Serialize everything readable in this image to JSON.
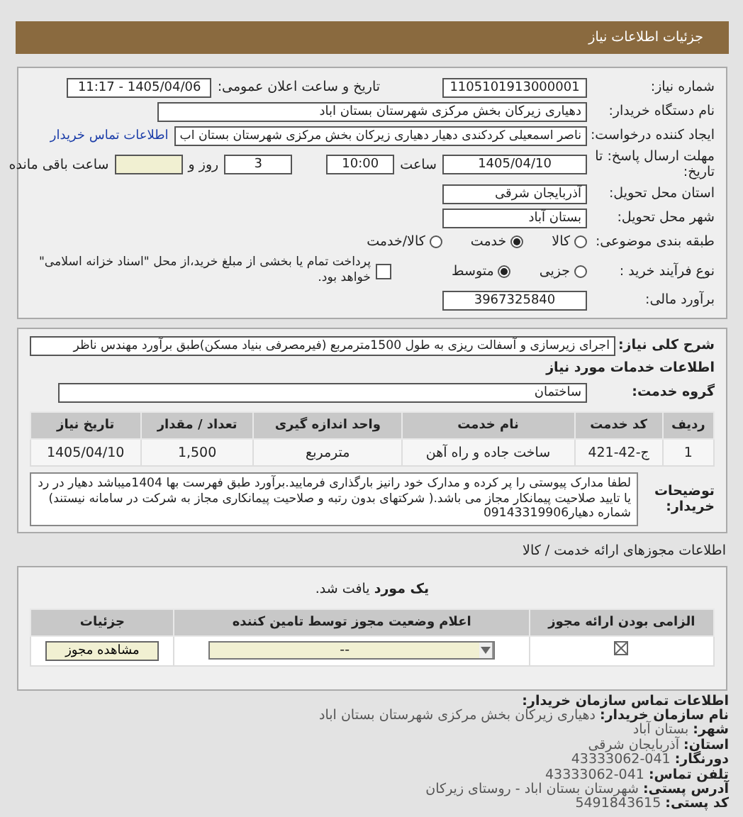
{
  "title": "جزئیات اطلاعات نیاز",
  "need_number": {
    "label": "شماره نیاز:",
    "value": "1105101913000001"
  },
  "announce": {
    "label": "تاریخ و ساعت اعلان عمومی:",
    "value": "1405/04/06 - 11:17"
  },
  "buyer": {
    "label": "نام دستگاه خریدار:",
    "value": "دهیاری زیرکان بخش مرکزی شهرستان بستان اباد"
  },
  "requester": {
    "label": "ایجاد کننده درخواست:",
    "value": "ناصر اسمعیلی کردکندی دهیار دهیاری زیرکان بخش مرکزی شهرستان بستان اب",
    "link": "اطلاعات تماس خریدار"
  },
  "deadline": {
    "label": "مهلت ارسال پاسخ: تا تاریخ:",
    "date": "1405/04/10",
    "time_label": "ساعت",
    "time": "10:00",
    "days": "3",
    "days_label": "روز و",
    "remaining_label": "ساعت باقی مانده"
  },
  "province": {
    "label": "استان محل تحویل:",
    "value": "آذربایجان شرقی"
  },
  "city": {
    "label": "شهر محل تحویل:",
    "value": "بستان آباد"
  },
  "category": {
    "label": "طبقه بندی موضوعی:",
    "options": [
      {
        "label": "کالا",
        "selected": false
      },
      {
        "label": "خدمت",
        "selected": true
      },
      {
        "label": "کالا/خدمت",
        "selected": false
      }
    ]
  },
  "process": {
    "label": "نوع فرآیند خرید :",
    "options": [
      {
        "label": "جزیی",
        "selected": false
      },
      {
        "label": "متوسط",
        "selected": true
      }
    ],
    "treasury": {
      "label": "پرداخت تمام یا بخشی از مبلغ خرید،از محل \"اسناد خزانه اسلامی\" خواهد بود.",
      "checked": false
    }
  },
  "budget": {
    "label": "برآورد مالی:",
    "value": "3967325840"
  },
  "summary": {
    "label": "شرح کلی نیاز:",
    "value": "اجرای زیرسازی و آسفالت ریزی به طول 1500مترمربع (فیرمصرفی بنیاد مسکن)طبق برآورد مهندس ناظر"
  },
  "services_heading": "اطلاعات خدمات مورد نیاز",
  "service_group": {
    "label": "گروه خدمت:",
    "value": "ساختمان"
  },
  "services_table": {
    "columns": [
      "ردیف",
      "کد خدمت",
      "نام خدمت",
      "واحد اندازه گیری",
      "تعداد / مقدار",
      "تاریخ نیاز"
    ],
    "rows": [
      [
        "1",
        "ج-42-421",
        "ساخت جاده و راه آهن",
        "مترمربع",
        "1,500",
        "1405/04/10"
      ]
    ]
  },
  "notes": {
    "label": "توضیحات خریدار:",
    "value": "لطفا مدارک پیوستی را پر کرده و مدارک خود رانیز بارگذاری فرمایید.برآورد طبق فهرست بها 1404میباشد دهیار در رد یا تایید صلاحیت پیمانکار مجاز می باشد.( شرکتهای بدون رتبه و صلاحیت پیمانکاری مجاز به شرکت در سامانه نیستند) شماره دهیار09143319906"
  },
  "licenses_heading": "اطلاعات مجوزهای ارائه خدمت / کالا",
  "licenses": {
    "result": "**یک مورد** یافت شد.",
    "columns": [
      "الزامی بودن ارائه مجوز",
      "اعلام وضعیت مجوز توسط تامین کننده",
      "جزئیات"
    ],
    "rows": [
      {
        "required": true,
        "status": "--",
        "button": "مشاهده مجوز"
      }
    ]
  },
  "contact": {
    "title": "اطلاعات تماس سازمان خریدار:",
    "lines": [
      {
        "label": "نام سازمان خریدار:",
        "value": "دهیاری زیرکان بخش مرکزی شهرستان بستان اباد"
      },
      {
        "label": "شهر:",
        "value": "بستان آباد"
      },
      {
        "label": "استان:",
        "value": "آذربایجان شرقی"
      },
      {
        "label": "دورنگار:",
        "value": "041-43333062"
      },
      {
        "label": "تلفن تماس:",
        "value": "041-43333062"
      },
      {
        "label": "آدرس پستی:",
        "value": "شهرستان بستان اباد - روستای زیرکان"
      },
      {
        "label": "کد پستی:",
        "value": "5491843615"
      }
    ]
  }
}
